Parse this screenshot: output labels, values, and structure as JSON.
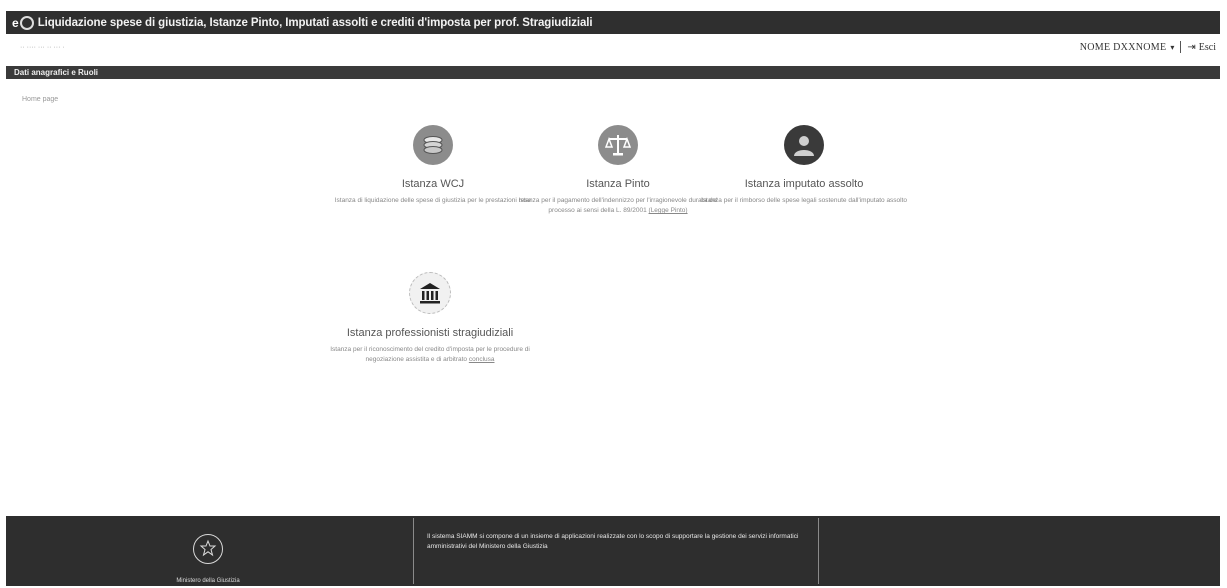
{
  "header": {
    "app_title": "Liquidazione spese di giustizia, Istanze Pinto, Imputati assolti e crediti d'imposta per prof. Stragiudiziali"
  },
  "user": {
    "name": "NOME DXXNOME",
    "caret": "▾",
    "exit_label": "Esci"
  },
  "section": {
    "title": "Dati anagrafici e Ruoli"
  },
  "breadcrumb": "Home page",
  "cards": [
    {
      "icon": "coins-icon",
      "title": "Istanza WCJ",
      "desc": "Istanza di liquidazione delle spese di giustizia per le prestazioni rese"
    },
    {
      "icon": "scales-icon",
      "title": "Istanza Pinto",
      "desc": "Istanza per il pagamento dell'indennizzo per l'irragionevole durata del processo ai sensi della L. 89/2001",
      "link": "(Legge Pinto)"
    },
    {
      "icon": "person-icon",
      "title": "Istanza imputato assolto",
      "desc": "Istanza per il rimborso delle spese legali sostenute dall'imputato assolto"
    },
    {
      "icon": "courthouse-icon",
      "title": "Istanza professionisti stragiudiziali",
      "desc": "Istanza per il riconoscimento del credito d'imposta per le procedure di negoziazione assistita e di arbitrato",
      "link": "conclusa"
    }
  ],
  "footer": {
    "ministry": "Ministero della Giustizia",
    "note": "Il sistema SIAMM si compone di un insieme di applicazioni realizzate con lo scopo di supportare la gestione dei servizi informatici amministrativi del Ministero della Giustizia"
  },
  "colors": {
    "header_bg": "#2f2f2f",
    "icon_bg": "#8c8c8c",
    "icon_dark": "#3a3a3a",
    "footer_bg": "#2e2e2e"
  }
}
